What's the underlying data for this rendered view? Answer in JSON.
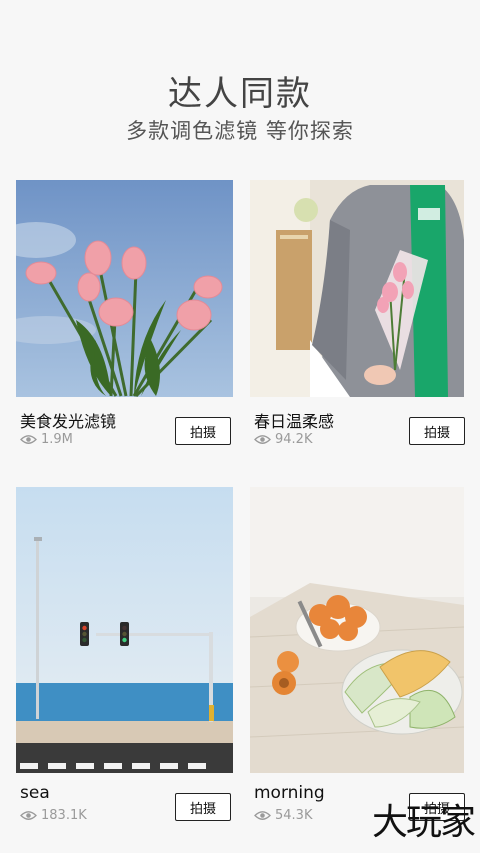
{
  "header": {
    "title": "达人同款",
    "subtitle": "多款调色滤镜 等你探索"
  },
  "cards": [
    {
      "name": "美食发光滤镜",
      "views": "1.9M",
      "button": "拍摄"
    },
    {
      "name": "春日温柔感",
      "views": "94.2K",
      "button": "拍摄"
    },
    {
      "name": "sea",
      "views": "183.1K",
      "button": "拍摄"
    },
    {
      "name": "morning",
      "views": "54.3K",
      "button": "拍摄"
    }
  ],
  "watermark": "大玩家",
  "colors": {
    "page_background": "#f7f7f7",
    "button_border": "#222222",
    "muted_text": "#9a9a9a"
  }
}
